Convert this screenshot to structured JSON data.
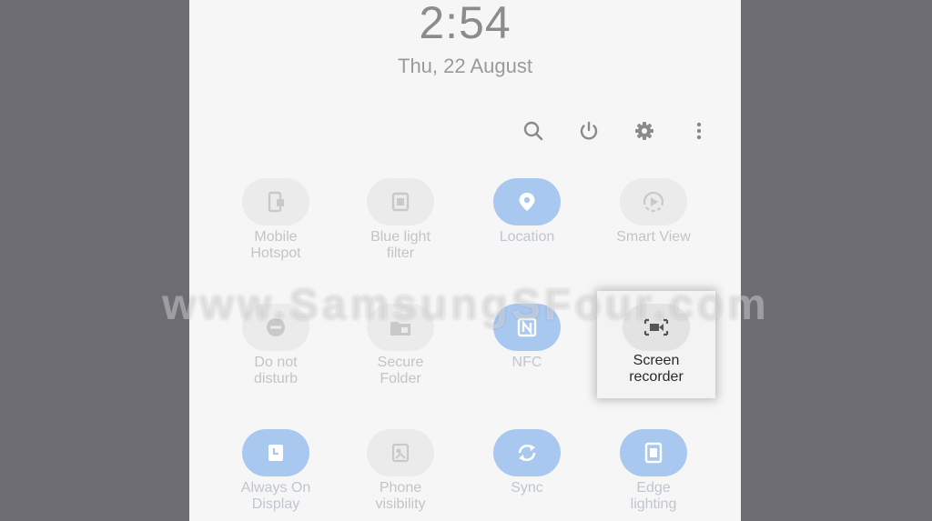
{
  "status": {
    "time": "2:54",
    "date": "Thu, 22 August"
  },
  "toolbar": [
    {
      "icon": "search-icon"
    },
    {
      "icon": "power-icon"
    },
    {
      "icon": "settings-icon"
    },
    {
      "icon": "more-options-icon"
    }
  ],
  "tiles": [
    {
      "label": "Mobile\nHotspot",
      "active": false,
      "icon": "mobile-hotspot-icon"
    },
    {
      "label": "Blue light\nfilter",
      "active": false,
      "icon": "blue-light-filter-icon"
    },
    {
      "label": "Location",
      "active": true,
      "icon": "location-icon"
    },
    {
      "label": "Smart View",
      "active": false,
      "icon": "smart-view-icon"
    },
    {
      "label": "Do not\ndisturb",
      "active": false,
      "icon": "do-not-disturb-icon"
    },
    {
      "label": "Secure\nFolder",
      "active": false,
      "icon": "secure-folder-icon"
    },
    {
      "label": "NFC",
      "active": true,
      "icon": "nfc-icon"
    },
    {
      "label": "Screen\nrecorder",
      "active": false,
      "highlighted": true,
      "icon": "screen-recorder-icon"
    },
    {
      "label": "Always On\nDisplay",
      "active": true,
      "icon": "always-on-display-icon"
    },
    {
      "label": "Phone\nvisibility",
      "active": false,
      "icon": "phone-visibility-icon"
    },
    {
      "label": "Sync",
      "active": true,
      "icon": "sync-icon"
    },
    {
      "label": "Edge\nlighting",
      "active": true,
      "icon": "edge-lighting-icon"
    }
  ],
  "watermark": "www.SamsungSFour.com",
  "colors": {
    "active_tile": "#a9c8f0",
    "inactive_tile": "#ebebeb",
    "icon_active": "#ffffff",
    "icon_inactive": "#c9c9c9"
  }
}
